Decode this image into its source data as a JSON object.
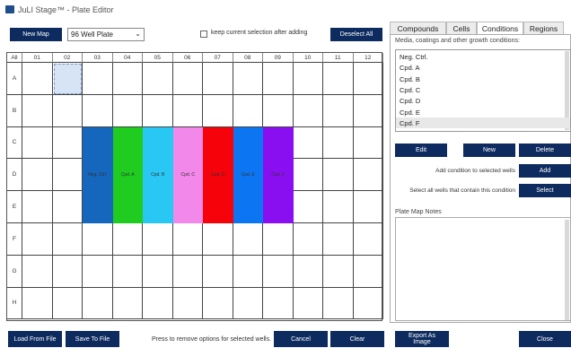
{
  "window": {
    "title": "JuLI Stage™ - Plate Editor"
  },
  "toolbar": {
    "new_map": "New Map",
    "plate_type": "96 Well Plate",
    "keep_selection_label": "keep current selection after adding",
    "deselect_all": "Deselect All"
  },
  "grid": {
    "all_label": "All",
    "columns": [
      "01",
      "02",
      "03",
      "04",
      "05",
      "06",
      "07",
      "08",
      "09",
      "10",
      "11",
      "12"
    ],
    "rows": [
      "A",
      "B",
      "C",
      "D",
      "E",
      "F",
      "G",
      "H"
    ],
    "conditions": [
      {
        "label": "Neg. Ctrl.",
        "color": "#1566bd"
      },
      {
        "label": "Cpd. A",
        "color": "#1fcc1f"
      },
      {
        "label": "Cpd. B",
        "color": "#29c8f4"
      },
      {
        "label": "Cpd. C",
        "color": "#f288ea"
      },
      {
        "label": "Cpd. D",
        "color": "#f5020b"
      },
      {
        "label": "Cpd. E",
        "color": "#0c76f2"
      },
      {
        "label": "Cpd. F",
        "color": "#8a0ff0"
      }
    ]
  },
  "tabs": [
    "Compounds",
    "Cells",
    "Conditions",
    "Regions"
  ],
  "active_tab": "Conditions",
  "conditions_panel": {
    "label": "Media, coatings and other growth conditions:",
    "items": [
      "Neg. Ctrl.",
      "Cpd. A",
      "Cpd. B",
      "Cpd. C",
      "Cpd. D",
      "Cpd. E",
      "Cpd. F"
    ],
    "selected": "Cpd. F",
    "edit": "Edit",
    "new": "New",
    "delete": "Delete",
    "add_text": "Add condition to selected wells",
    "add": "Add",
    "select_text": "Select all wells that contain this condition",
    "select": "Select"
  },
  "notes": {
    "label": "Plate Map Notes"
  },
  "footer": {
    "load": "Load From File",
    "save": "Save To File",
    "hint": "Press to remove options for selected wells.",
    "cancel": "Cancel",
    "clear": "Clear",
    "export": "Export As Image",
    "close": "Close"
  }
}
